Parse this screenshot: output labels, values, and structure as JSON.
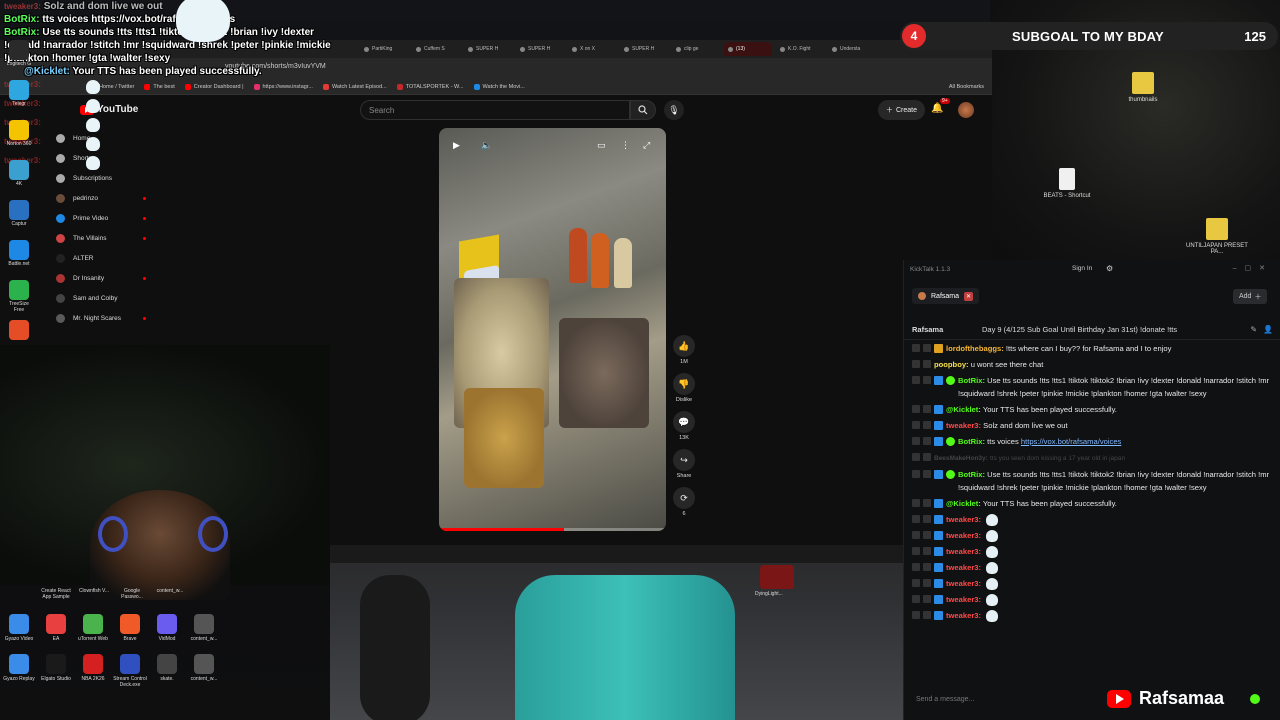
{
  "overlay_chat": {
    "line1_user": "tweaker3:",
    "line1_text": "Solz and dom live we out",
    "line2_user": "BotRix:",
    "line2_text": "tts voices https://vox.bot/rafsama/voices",
    "line3_user": "BotRix:",
    "line3_text": "Use tts sounds !tts !tts1 !tiktok !tiktok2 !brian !ivy !dexter !donald !narrador !stitch !mr !squidward !shrek !peter !pinkie !mickie !plankton !homer !gta !walter !sexy",
    "line4_user": "@Kicklet:",
    "line4_text": "Your TTS has been played successfully.",
    "ghost_user": "tweaker3:"
  },
  "subgoal": {
    "number": "4",
    "title": "SUBGOAL TO MY BDAY",
    "count": "125"
  },
  "desktop_icons_right": [
    {
      "label": "thumbnails",
      "color": "#e8c840"
    },
    {
      "label": "BEATS - Shortcut",
      "color": "#f0f0f0"
    },
    {
      "label": "UNTILJAPAN PRESET PA...",
      "color": "#e8c840"
    }
  ],
  "browser": {
    "tabs": [
      "PartiKing",
      "Cuffem S",
      "SUPER H",
      "SUPER H",
      "X on X",
      "SUPER H",
      "clip ge",
      "(13)",
      "K.O. Fight",
      "Understa"
    ],
    "active_tab_index": 7,
    "url": "youtube.com/shorts/m3vIuvYVM",
    "bookmarks": [
      "Home / Twitter",
      "The best",
      "Creator Dashboard |",
      "https://www.instagr...",
      "Watch Latest Episod...",
      "TOTALSPORTEK - W...",
      "Watch the Movi..."
    ],
    "all_bookmarks": "All Bookmarks"
  },
  "youtube": {
    "logo": "YouTube",
    "search_placeholder": "Search",
    "create_label": "Create",
    "notifications": "9+",
    "sidebar": [
      "Home",
      "Shorts",
      "Subscriptions",
      "pedrinzo",
      "Prime Video",
      "The Villains",
      "ALTER",
      "Dr Insanity",
      "Sam and Colby",
      "Mr. Night Scares"
    ],
    "actions": [
      {
        "icon": "like-icon",
        "label": "1M"
      },
      {
        "icon": "dislike-icon",
        "label": "Dislike"
      },
      {
        "icon": "comment-icon",
        "label": "13K"
      },
      {
        "icon": "share-icon",
        "label": "Share"
      },
      {
        "icon": "remix-icon",
        "label": "6"
      }
    ],
    "progress": 0.55
  },
  "desktop_icons_left": [
    {
      "label": "Gyazo Video",
      "color": "#3b8be8"
    },
    {
      "label": "EA",
      "color": "#e84040"
    },
    {
      "label": "uTorrent Web",
      "color": "#4bb34b"
    },
    {
      "label": "Brave",
      "color": "#f05a28"
    },
    {
      "label": "VidMod",
      "color": "#6b5cf0"
    },
    {
      "label": "content_w...",
      "color": "#555555"
    },
    {
      "label": "Gyazo Replay",
      "color": "#3b8be8"
    },
    {
      "label": "Elgato Studio",
      "color": "#1a1a1a"
    },
    {
      "label": "NBA 2K26",
      "color": "#d42020"
    },
    {
      "label": "Stream Control Deck.exe",
      "color": "#3050c0"
    },
    {
      "label": "skate.",
      "color": "#444444"
    },
    {
      "label": "content_w...",
      "color": "#555555"
    }
  ],
  "desktop_icons_left_top": [
    {
      "label": "Create React App Sample",
      "color": "#2a2a2a"
    },
    {
      "label": "Clownfish V...",
      "color": "#2a2a2a"
    },
    {
      "label": "Google Passwo...",
      "color": "#2a2a2a"
    },
    {
      "label": "content_w...",
      "color": "#2a2a2a"
    }
  ],
  "left_column_icons": [
    {
      "label": "Logitech G",
      "color": "#2a2a2a"
    },
    {
      "label": "Telegr",
      "color": "#2ea6e0"
    },
    {
      "label": "Norton 360",
      "color": "#f5c400"
    },
    {
      "label": "4K",
      "color": "#3ba0d0"
    },
    {
      "label": "Captur",
      "color": "#2a70c0"
    },
    {
      "label": "Battle.net",
      "color": "#1e88e5"
    },
    {
      "label": "TreeSize Free",
      "color": "#2bb24c"
    },
    {
      "label": "",
      "color": "#e44d26"
    }
  ],
  "bottom_media": {
    "tile_label": "DyingLight..."
  },
  "kicktalk": {
    "app_title": "KickTalk 1.1.3",
    "sign_in": "Sign In",
    "tab_name": "Rafsama",
    "add_label": "Add",
    "channel": "Rafsama",
    "stream_title": "Day 9 (4/125 Sub Goal Until Birthday Jan 31st) !donate !tts",
    "messages": [
      {
        "user": "lordofthebaggs:",
        "cls": "u-lord",
        "text": "!tts where can I buy?? for Rafsama and I to enjoy",
        "badges": "gold"
      },
      {
        "user": "poopboy:",
        "cls": "u-poop",
        "text": "u wont see there chat",
        "badges": "none"
      },
      {
        "user": "BotRix:",
        "cls": "u-bot2",
        "text": "Use tts sounds !tts !tts1 !tiktok !tiktok2 !brian !ivy !dexter !donald !narrador !stitch !mr !squidward !shrek !peter !pinkie !mickie !plankton !homer !gta !walter !sexy",
        "badges": "bot"
      },
      {
        "user": "@Kicklet:",
        "cls": "u-kick2",
        "text": "Your TTS has been played successfully.",
        "badges": "kick"
      },
      {
        "user": "tweaker3:",
        "cls": "u-tw2",
        "text": "Solz and dom live we out",
        "badges": "kick"
      },
      {
        "user": "BotRix:",
        "cls": "u-bot2",
        "text": "tts voices ",
        "link": "https://vox.bot/rafsama/voices",
        "badges": "bot"
      },
      {
        "user": "BeesMakeHon3y:",
        "cls": "u-deleted",
        "text": "tts you seen dom kissing a 17 year old in japan",
        "badges": "none",
        "deleted": true
      },
      {
        "user": "BotRix:",
        "cls": "u-bot2",
        "text": "Use tts sounds !tts !tts1 !tiktok !tiktok2 !brian !ivy !dexter !donald !narrador !stitch !mr !squidward !shrek !peter !pinkie !mickie !plankton !homer !gta !walter !sexy",
        "badges": "bot"
      },
      {
        "user": "@Kicklet:",
        "cls": "u-kick2",
        "text": "Your TTS has been played successfully.",
        "badges": "kick"
      },
      {
        "user": "tweaker3:",
        "cls": "u-tw2",
        "text": "",
        "badges": "kick",
        "emote": true
      },
      {
        "user": "tweaker3:",
        "cls": "u-tw2",
        "text": "",
        "badges": "kick",
        "emote": true
      },
      {
        "user": "tweaker3:",
        "cls": "u-tw2",
        "text": "",
        "badges": "kick",
        "emote": true
      },
      {
        "user": "tweaker3:",
        "cls": "u-tw2",
        "text": "",
        "badges": "kick",
        "emote": true
      },
      {
        "user": "tweaker3:",
        "cls": "u-tw2",
        "text": "",
        "badges": "kick",
        "emote": true
      },
      {
        "user": "tweaker3:",
        "cls": "u-tw2",
        "text": "",
        "badges": "kick",
        "emote": true
      },
      {
        "user": "tweaker3:",
        "cls": "u-tw2",
        "text": "",
        "badges": "kick",
        "emote": true
      }
    ],
    "input_placeholder": "Send a message..."
  },
  "yt_handle": "Rafsamaa"
}
